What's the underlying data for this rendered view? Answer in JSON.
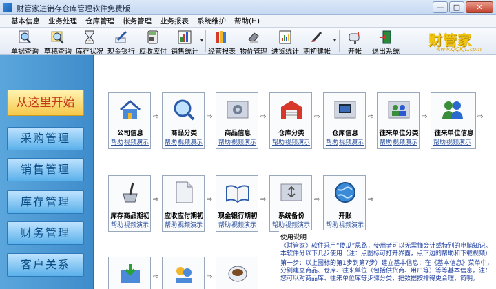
{
  "window": {
    "title": "财管家进销存仓库管理软件免费版",
    "min": "—",
    "max": "□",
    "close": "✕"
  },
  "menubar": [
    "基本信息",
    "业务处理",
    "仓库管理",
    "帐务管理",
    "业务报表",
    "系统维护",
    "帮助(H)"
  ],
  "toolbar": [
    {
      "label": "单据查询",
      "icon": "magnifier-doc-icon"
    },
    {
      "label": "草稿查询",
      "icon": "magnifier-draft-icon"
    },
    {
      "label": "库存状况",
      "icon": "hourglass-icon"
    },
    {
      "label": "现金银行",
      "icon": "pen-icon"
    },
    {
      "label": "应收应付",
      "icon": "calculator-icon"
    },
    {
      "label": "销售统计",
      "icon": "bar-chart-icon"
    },
    {
      "label": "经营报表",
      "icon": "books-icon"
    },
    {
      "label": "物价管理",
      "icon": "scanner-icon"
    },
    {
      "label": "进货统计",
      "icon": "report-chart-icon"
    },
    {
      "label": "期初建帐",
      "icon": "brush-icon"
    },
    {
      "label": "开帐",
      "icon": "mailbox-icon"
    },
    {
      "label": "退出系统",
      "icon": "exit-door-icon"
    }
  ],
  "brand": {
    "name": "财管家",
    "url": "www.QQKJL.com"
  },
  "sidebar": {
    "start": "从这里开始",
    "items": [
      "采购管理",
      "销售管理",
      "库存管理",
      "财务管理",
      "客户关系"
    ]
  },
  "modules_row1": [
    {
      "name": "公司信息",
      "icon": "house-icon"
    },
    {
      "name": "商品分类",
      "icon": "magnifier-search-icon"
    },
    {
      "name": "商品信息",
      "icon": "gear-folder-icon"
    },
    {
      "name": "仓库分类",
      "icon": "warehouse-icon"
    },
    {
      "name": "仓库信息",
      "icon": "monitor-folder-icon"
    },
    {
      "name": "往来单位分类",
      "icon": "people-folder-icon"
    },
    {
      "name": "往来单位信息",
      "icon": "user-group-icon"
    }
  ],
  "modules_row2": [
    {
      "name": "库存商品期初",
      "icon": "brush-cup-icon"
    },
    {
      "name": "应收应付期初",
      "icon": "blank-doc-icon"
    },
    {
      "name": "现金银行期初",
      "icon": "open-book-icon"
    },
    {
      "name": "系统备份",
      "icon": "usb-folder-icon"
    },
    {
      "name": "开账",
      "icon": "globe-icon"
    }
  ],
  "modules_row3": [
    {
      "name": "",
      "icon": "download-icon"
    },
    {
      "name": "",
      "icon": "people-icon"
    },
    {
      "name": "",
      "icon": "coffee-cup-icon"
    }
  ],
  "links": {
    "help": "帮助",
    "video": "视频演示"
  },
  "usage": {
    "title": "使用说明",
    "p1": "《财管家》软件采用“傻瓜”思路，使用者可以无需懂会计或特别的电脑知识。本软件分以下几步使用（注：点图标可打开界面，点下边的帮助和下载视频）",
    "p2": "第一步：以上图标的第1步到第7步）建立基本信息：在《基本信息》菜单中，分别建立商品、仓库、往来单位（包括供货商、用户等）等等基本信息。注：您可以对商品库、往来单位库等步骤分类，把数据按排得更合理、简明。"
  },
  "colors": {
    "accent": "#3f8ccb",
    "start": "#f6c84a",
    "link": "#2b4f9a"
  }
}
